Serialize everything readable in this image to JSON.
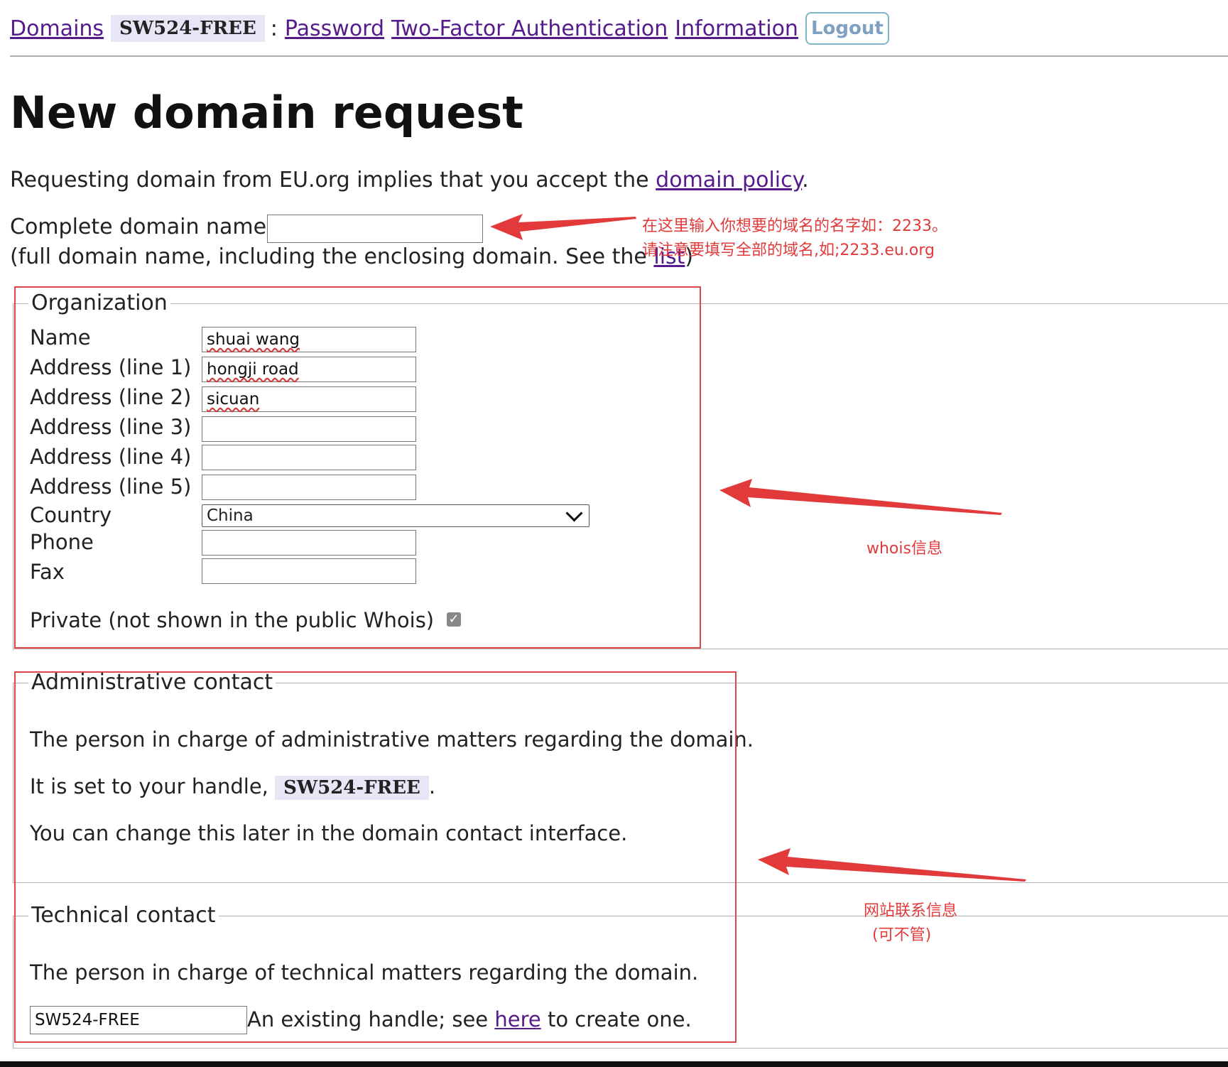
{
  "nav": {
    "domains": "Domains",
    "handle": "SW524-FREE",
    "separator": ":",
    "password": "Password",
    "two_factor": "Two-Factor Authentication",
    "information": "Information",
    "logout": "Logout"
  },
  "page": {
    "title": "New domain request",
    "intro_prefix": "Requesting domain from EU.org implies that you accept the ",
    "policy_link": "domain policy",
    "intro_suffix": "."
  },
  "domain_field": {
    "label": "Complete domain name",
    "value": "",
    "help_prefix": "(full domain name, including the enclosing domain. See the ",
    "help_link": "list",
    "help_suffix": ")"
  },
  "organization": {
    "legend": "Organization",
    "fields": [
      {
        "label": "Name",
        "value": "shuai wang"
      },
      {
        "label": "Address (line 1)",
        "value": "hongji road"
      },
      {
        "label": "Address (line 2)",
        "value": "sicuan"
      },
      {
        "label": "Address (line 3)",
        "value": ""
      },
      {
        "label": "Address (line 4)",
        "value": ""
      },
      {
        "label": "Address (line 5)",
        "value": ""
      }
    ],
    "country_label": "Country",
    "country_value": "China",
    "phone_label": "Phone",
    "phone_value": "",
    "fax_label": "Fax",
    "fax_value": "",
    "private_label": "Private (not shown in the public Whois)",
    "private_checked": true
  },
  "admin": {
    "legend": "Administrative contact",
    "line1": "The person in charge of administrative matters regarding the domain.",
    "line2_prefix": "It is set to your handle, ",
    "handle": "SW524-FREE",
    "line2_suffix": ".",
    "line3": "You can change this later in the domain contact interface."
  },
  "tech": {
    "legend": "Technical contact",
    "line1": "The person in charge of technical matters regarding the domain.",
    "handle_value": "SW524-FREE",
    "hint_prefix": "An existing handle; see ",
    "hint_link": "here",
    "hint_suffix": " to create one."
  },
  "annotations": {
    "domain_note_1": "在这里输入你想要的域名的名字如：2233。",
    "domain_note_2": "请注意要填写全部的域名,如;2233.eu.org",
    "whois_note": "whois信息",
    "contact_note_1": "网站联系信息",
    "contact_note_2": "(可不管)",
    "color": "#e23a3a"
  }
}
